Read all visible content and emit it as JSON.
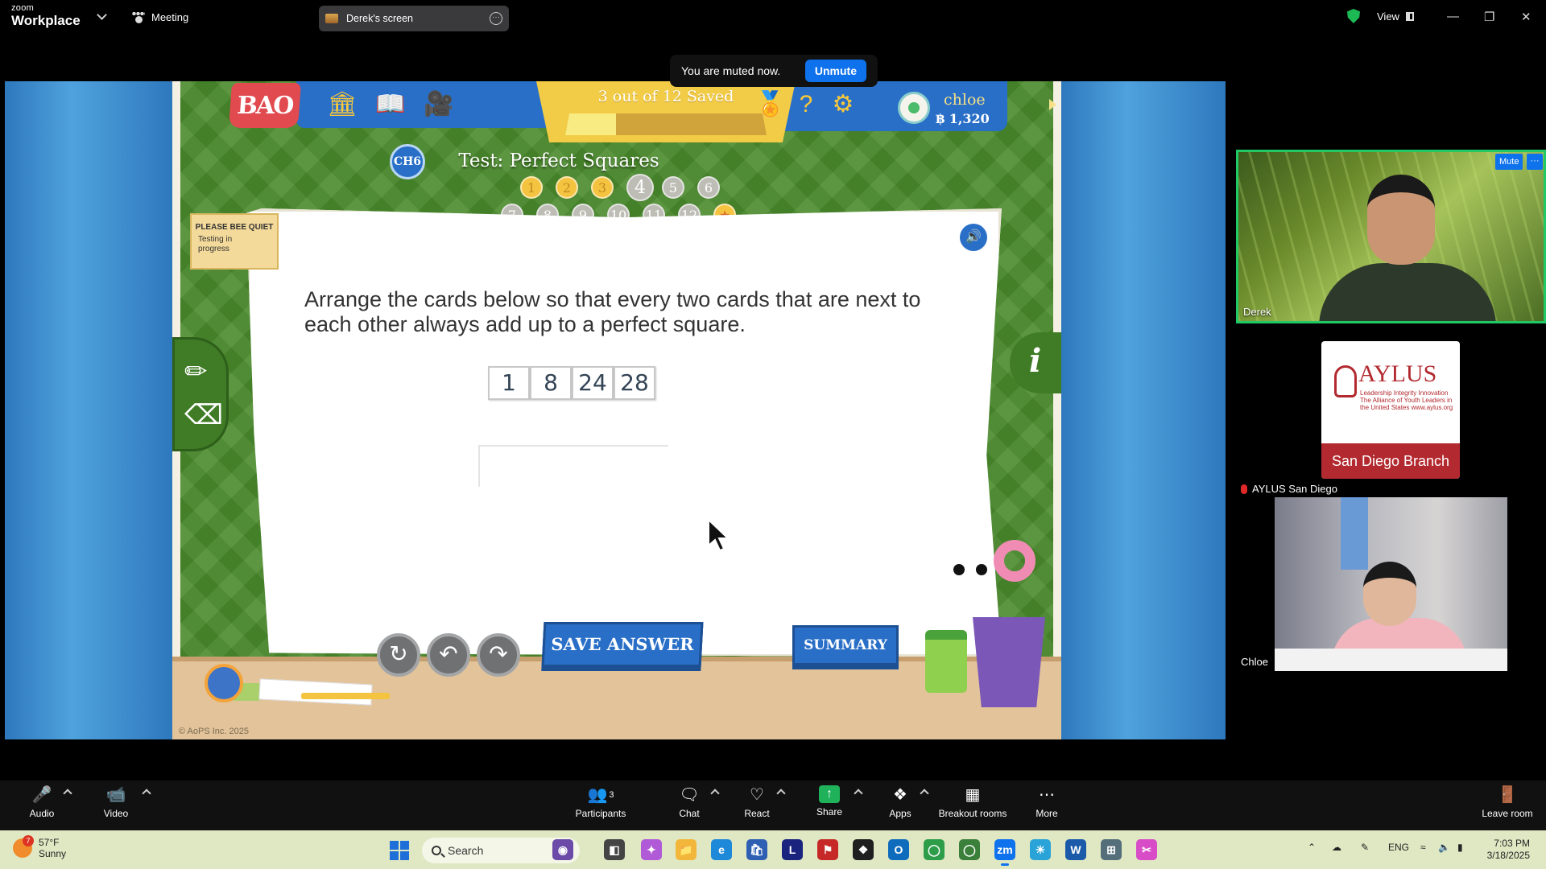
{
  "titlebar": {
    "brand_small": "zoom",
    "brand_big": "Workplace",
    "meeting_label": "Meeting",
    "share_title": "Derek's screen",
    "view_label": "View"
  },
  "toast": {
    "message": "You are muted now.",
    "button": "Unmute"
  },
  "game": {
    "logo": "BAO",
    "saved_text": "3 out of 12 Saved",
    "saved_progress": 0.25,
    "user_name": "chloe",
    "coins": "฿ 1,320",
    "chapter_badge": "CH6",
    "test_title": "Test: Perfect Squares",
    "question_numbers_row1": [
      "1",
      "2",
      "3",
      "4",
      "5",
      "6"
    ],
    "question_numbers_row2": [
      "7",
      "8",
      "9",
      "10",
      "11",
      "12"
    ],
    "sign_title": "PLEASE BEE QUIET",
    "sign_text": "Testing in progress",
    "question": "Arrange the cards below so that every two cards that are next to each other always add up to a perfect square.",
    "cards": [
      "1",
      "8",
      "24",
      "28"
    ],
    "save_answer": "SAVE ANSWER",
    "summary": "SUMMARY",
    "copyright": "© AoPS Inc. 2025"
  },
  "participants": {
    "derek": {
      "name": "Derek",
      "mute_label": "Mute"
    },
    "aylus": {
      "name": "AYLUS San Diego",
      "logo_word": "AYLUS",
      "tagline": "Leadership Integrity Innovation The Alliance of Youth Leaders in the United States www.aylus.org",
      "branch": "San Diego Branch"
    },
    "chloe": {
      "name": "Chloe"
    }
  },
  "toolbar": {
    "audio": "Audio",
    "video": "Video",
    "participants": "Participants",
    "participants_count": "3",
    "chat": "Chat",
    "react": "React",
    "share": "Share",
    "apps": "Apps",
    "breakout": "Breakout rooms",
    "more": "More",
    "leave": "Leave room"
  },
  "taskbar": {
    "temp": "57°F",
    "weather": "Sunny",
    "weather_badge": "7",
    "search": "Search",
    "lang": "ENG",
    "time": "7:03 PM",
    "date": "3/18/2025"
  },
  "colors": {
    "zoom_blue": "#0e72ed",
    "active_speaker": "#20c963",
    "game_blue": "#2a6fc7",
    "game_green": "#4a8a2c"
  }
}
